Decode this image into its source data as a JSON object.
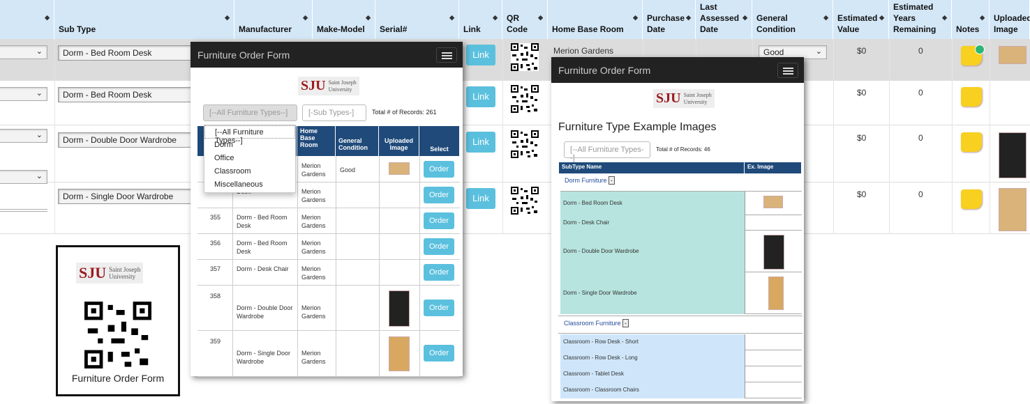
{
  "grid": {
    "headers": [
      {
        "label": "",
        "key": "h0"
      },
      {
        "label": "Sub Type",
        "key": "subtype"
      },
      {
        "label": "Manufacturer",
        "key": "mfr"
      },
      {
        "label": "Make-Model",
        "key": "model"
      },
      {
        "label": "Serial#",
        "key": "serial"
      },
      {
        "label": "Link",
        "key": "link"
      },
      {
        "label": "QR Code",
        "key": "qr"
      },
      {
        "label": "Home Base Room",
        "key": "room"
      },
      {
        "label": "Purchase Date",
        "key": "pdate"
      },
      {
        "label": "Last Assessed Date",
        "key": "adate"
      },
      {
        "label": "General Condition",
        "key": "cond"
      },
      {
        "label": "Estimated Value",
        "key": "value"
      },
      {
        "label": "Estimated Years Remaining",
        "key": "years"
      },
      {
        "label": "Notes",
        "key": "notes"
      },
      {
        "label": "Uploaded Image",
        "key": "img"
      }
    ],
    "rows": [
      {
        "subtype": "Dorm - Bed Room Desk",
        "link": "Link",
        "room": "Merion Gardens",
        "condition": "Good",
        "value": "$0",
        "years": "0"
      },
      {
        "subtype": "Dorm - Bed Room Desk",
        "link": "Link",
        "room": "",
        "condition": "",
        "value": "$0",
        "years": "0"
      },
      {
        "subtype": "Dorm - Double Door Wardrobe",
        "link": "Link",
        "room": "",
        "condition": "",
        "value": "$0",
        "years": "0"
      },
      {
        "subtype": "Dorm - Single Door Wardrobe",
        "link": "Link",
        "room": "",
        "condition": "",
        "value": "$0",
        "years": "0"
      }
    ]
  },
  "qr_card": {
    "logo_sju": "SJU",
    "logo_line1": "Saint Joseph",
    "logo_line2": "University",
    "caption": "Furniture Order Form"
  },
  "order_form": {
    "title": "Furniture Order Form",
    "filter_type": "[--All Furniture Types--]",
    "filter_sub": "[-Sub Types-]",
    "records": "Total # of Records: 261",
    "dropdown": [
      "[--All Furniture Types--]",
      "Dorm",
      "Office",
      "Classroom",
      "Miscellaneous"
    ],
    "headers": {
      "room": "Home Base Room",
      "cond": "General Condition",
      "img": "Uploaded Image",
      "select": "Select"
    },
    "rows": [
      {
        "id": "",
        "sub": "",
        "room": "Merion Gardens",
        "cond": "Good",
        "btn": "Order"
      },
      {
        "id": "",
        "sub": "Desk",
        "room": "Merion Gardens",
        "cond": "",
        "btn": "Order"
      },
      {
        "id": "355",
        "sub": "Dorm - Bed Room Desk",
        "room": "Merion Gardens",
        "cond": "",
        "btn": "Order"
      },
      {
        "id": "356",
        "sub": "Dorm - Bed Room Desk",
        "room": "Merion Gardens",
        "cond": "",
        "btn": "Order"
      },
      {
        "id": "357",
        "sub": "Dorm - Desk Chair",
        "room": "Merion Gardens",
        "cond": "",
        "btn": "Order"
      },
      {
        "id": "358",
        "sub": "Dorm - Double Door Wardrobe",
        "room": "Merion Gardens",
        "cond": "",
        "btn": "Order"
      },
      {
        "id": "359",
        "sub": "Dorm - Single Door Wardrobe",
        "room": "Merion Gardens",
        "cond": "",
        "btn": "Order"
      }
    ]
  },
  "examples": {
    "title": "Furniture Order Form",
    "heading": "Furniture Type Example Images",
    "filter": "[--All Furniture Types--]",
    "records": "Total # of Records: 46",
    "col1": "SubType Name",
    "col2": "Ex. Image",
    "group1": "Dorm Furniture",
    "group2": "Classroom Furniture",
    "toggle": "-",
    "dorm": [
      "Dorm - Bed Room Desk",
      "Dorm - Desk Chair",
      "Dorm - Double Door Wardrobe",
      "Dorm - Single Door Wardrobe"
    ],
    "classroom": [
      "Classroom - Row Desk - Short",
      "Classroom - Row Desk - Long",
      "Classroom - Tablet Desk",
      "Classroom - Classroom Chairs"
    ]
  },
  "colors": {
    "header_bg": "#d3e7f7",
    "link_btn": "#5bc0de",
    "table_head": "#1f4a7a",
    "dorm_row": "#b7e4de",
    "class_row": "#cfe6fa",
    "brand": "#9a1b1f"
  }
}
